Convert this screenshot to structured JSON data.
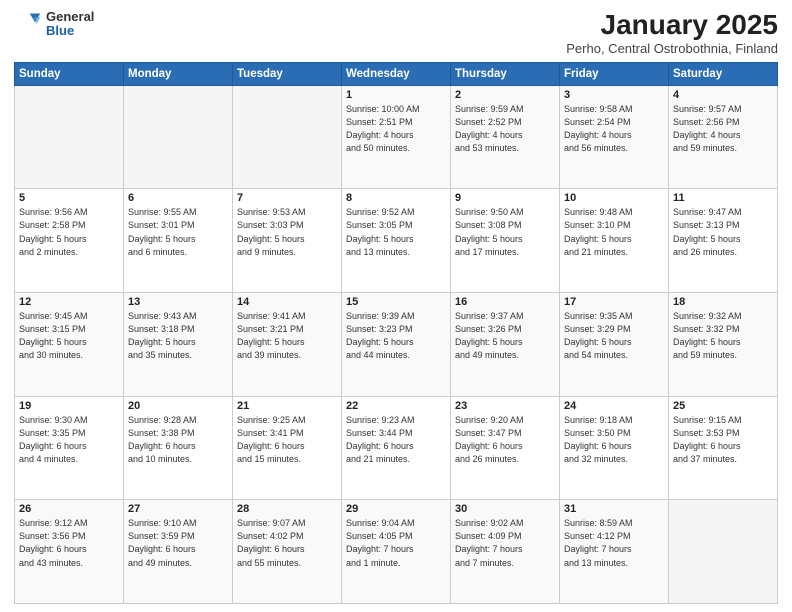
{
  "logo": {
    "general": "General",
    "blue": "Blue"
  },
  "header": {
    "title": "January 2025",
    "subtitle": "Perho, Central Ostrobothnia, Finland"
  },
  "weekdays": [
    "Sunday",
    "Monday",
    "Tuesday",
    "Wednesday",
    "Thursday",
    "Friday",
    "Saturday"
  ],
  "weeks": [
    [
      {
        "day": "",
        "info": ""
      },
      {
        "day": "",
        "info": ""
      },
      {
        "day": "",
        "info": ""
      },
      {
        "day": "1",
        "info": "Sunrise: 10:00 AM\nSunset: 2:51 PM\nDaylight: 4 hours\nand 50 minutes."
      },
      {
        "day": "2",
        "info": "Sunrise: 9:59 AM\nSunset: 2:52 PM\nDaylight: 4 hours\nand 53 minutes."
      },
      {
        "day": "3",
        "info": "Sunrise: 9:58 AM\nSunset: 2:54 PM\nDaylight: 4 hours\nand 56 minutes."
      },
      {
        "day": "4",
        "info": "Sunrise: 9:57 AM\nSunset: 2:56 PM\nDaylight: 4 hours\nand 59 minutes."
      }
    ],
    [
      {
        "day": "5",
        "info": "Sunrise: 9:56 AM\nSunset: 2:58 PM\nDaylight: 5 hours\nand 2 minutes."
      },
      {
        "day": "6",
        "info": "Sunrise: 9:55 AM\nSunset: 3:01 PM\nDaylight: 5 hours\nand 6 minutes."
      },
      {
        "day": "7",
        "info": "Sunrise: 9:53 AM\nSunset: 3:03 PM\nDaylight: 5 hours\nand 9 minutes."
      },
      {
        "day": "8",
        "info": "Sunrise: 9:52 AM\nSunset: 3:05 PM\nDaylight: 5 hours\nand 13 minutes."
      },
      {
        "day": "9",
        "info": "Sunrise: 9:50 AM\nSunset: 3:08 PM\nDaylight: 5 hours\nand 17 minutes."
      },
      {
        "day": "10",
        "info": "Sunrise: 9:48 AM\nSunset: 3:10 PM\nDaylight: 5 hours\nand 21 minutes."
      },
      {
        "day": "11",
        "info": "Sunrise: 9:47 AM\nSunset: 3:13 PM\nDaylight: 5 hours\nand 26 minutes."
      }
    ],
    [
      {
        "day": "12",
        "info": "Sunrise: 9:45 AM\nSunset: 3:15 PM\nDaylight: 5 hours\nand 30 minutes."
      },
      {
        "day": "13",
        "info": "Sunrise: 9:43 AM\nSunset: 3:18 PM\nDaylight: 5 hours\nand 35 minutes."
      },
      {
        "day": "14",
        "info": "Sunrise: 9:41 AM\nSunset: 3:21 PM\nDaylight: 5 hours\nand 39 minutes."
      },
      {
        "day": "15",
        "info": "Sunrise: 9:39 AM\nSunset: 3:23 PM\nDaylight: 5 hours\nand 44 minutes."
      },
      {
        "day": "16",
        "info": "Sunrise: 9:37 AM\nSunset: 3:26 PM\nDaylight: 5 hours\nand 49 minutes."
      },
      {
        "day": "17",
        "info": "Sunrise: 9:35 AM\nSunset: 3:29 PM\nDaylight: 5 hours\nand 54 minutes."
      },
      {
        "day": "18",
        "info": "Sunrise: 9:32 AM\nSunset: 3:32 PM\nDaylight: 5 hours\nand 59 minutes."
      }
    ],
    [
      {
        "day": "19",
        "info": "Sunrise: 9:30 AM\nSunset: 3:35 PM\nDaylight: 6 hours\nand 4 minutes."
      },
      {
        "day": "20",
        "info": "Sunrise: 9:28 AM\nSunset: 3:38 PM\nDaylight: 6 hours\nand 10 minutes."
      },
      {
        "day": "21",
        "info": "Sunrise: 9:25 AM\nSunset: 3:41 PM\nDaylight: 6 hours\nand 15 minutes."
      },
      {
        "day": "22",
        "info": "Sunrise: 9:23 AM\nSunset: 3:44 PM\nDaylight: 6 hours\nand 21 minutes."
      },
      {
        "day": "23",
        "info": "Sunrise: 9:20 AM\nSunset: 3:47 PM\nDaylight: 6 hours\nand 26 minutes."
      },
      {
        "day": "24",
        "info": "Sunrise: 9:18 AM\nSunset: 3:50 PM\nDaylight: 6 hours\nand 32 minutes."
      },
      {
        "day": "25",
        "info": "Sunrise: 9:15 AM\nSunset: 3:53 PM\nDaylight: 6 hours\nand 37 minutes."
      }
    ],
    [
      {
        "day": "26",
        "info": "Sunrise: 9:12 AM\nSunset: 3:56 PM\nDaylight: 6 hours\nand 43 minutes."
      },
      {
        "day": "27",
        "info": "Sunrise: 9:10 AM\nSunset: 3:59 PM\nDaylight: 6 hours\nand 49 minutes."
      },
      {
        "day": "28",
        "info": "Sunrise: 9:07 AM\nSunset: 4:02 PM\nDaylight: 6 hours\nand 55 minutes."
      },
      {
        "day": "29",
        "info": "Sunrise: 9:04 AM\nSunset: 4:05 PM\nDaylight: 7 hours\nand 1 minute."
      },
      {
        "day": "30",
        "info": "Sunrise: 9:02 AM\nSunset: 4:09 PM\nDaylight: 7 hours\nand 7 minutes."
      },
      {
        "day": "31",
        "info": "Sunrise: 8:59 AM\nSunset: 4:12 PM\nDaylight: 7 hours\nand 13 minutes."
      },
      {
        "day": "",
        "info": ""
      }
    ]
  ]
}
